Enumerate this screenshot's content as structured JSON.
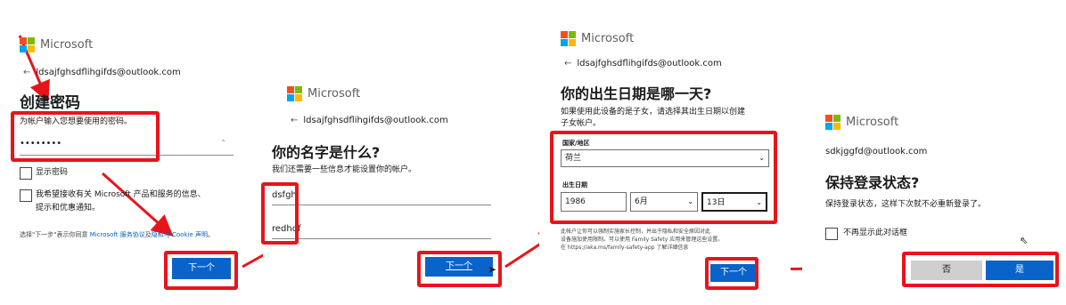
{
  "brand": {
    "name": "Microsoft",
    "colors": {
      "red": "#f25022",
      "green": "#7fba00",
      "blue": "#00a4ef",
      "yellow": "#ffb900"
    }
  },
  "annotation_color": "#e8141c",
  "step1": {
    "email": "ldsajfghsdflihgifds@outlook.com",
    "title": "创建密码",
    "prompt": "为帐户输入您想要使用的密码。",
    "password_mask": "••••••••",
    "show_password": "显示密码",
    "marketing_line1": "我希望接收有关 Microsoft 产品和服务的信息、",
    "marketing_line2": "提示和优惠通知。",
    "legal_prefix": "选择\"下一步\"表示你同意",
    "legal_link1": "Microsoft 服务协议",
    "legal_mid": "及",
    "legal_link2": "隐私与 Cookie 声明",
    "legal_suffix": "。",
    "next": "下一个"
  },
  "step2": {
    "email": "ldsajfghsdflihgifds@outlook.com",
    "title": "你的名字是什么?",
    "prompt": "我们还需要一些信息才能设置你的帐户。",
    "first_name": "dsfgh",
    "last_name": "redhdf",
    "next": "下一个"
  },
  "step3": {
    "email": "ldsajfghsdflihgifds@outlook.com",
    "title": "你的出生日期是哪一天?",
    "prompt_line1": "如果使用此设备的是子女，请选择其出生日期以创建",
    "prompt_line2": "子女帐户。",
    "country_label": "国家/地区",
    "country": "荷兰",
    "dob_label": "出生日期",
    "year": "1986",
    "month": "6月",
    "day": "13日",
    "notice_line1": "此帐户让你可以强制实施家长控制，并出于隐私和安全原因对此",
    "notice_line2": "设备施加使用限制。可以使用 Family Safety 应用来管理这些设置。",
    "notice_line3": "在 https://aka.ms/family-safety-app 了解详细信息",
    "next": "下一个"
  },
  "step4": {
    "email": "sdkjggfd@outlook.com",
    "title": "保持登录状态?",
    "prompt": "保持登录状态，这样下次就不必重新登录了。",
    "dont_show": "不再显示此对话框",
    "no": "否",
    "yes": "是"
  }
}
